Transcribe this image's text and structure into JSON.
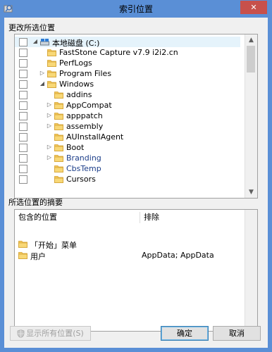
{
  "window": {
    "title": "索引位置",
    "close_glyph": "✕"
  },
  "locations_group": {
    "label": "更改所选位置",
    "items": [
      {
        "label": "本地磁盘 (C:)",
        "level": 0,
        "expanded": true,
        "icon": "drive-icon",
        "selected": true
      },
      {
        "label": "FastStone Capture v7.9 i2i2.cn",
        "level": 1,
        "icon": "folder-icon"
      },
      {
        "label": "PerfLogs",
        "level": 1,
        "icon": "folder-icon"
      },
      {
        "label": "Program Files",
        "level": 1,
        "collapsed": true,
        "icon": "folder-icon"
      },
      {
        "label": "Windows",
        "level": 1,
        "expanded": true,
        "icon": "folder-icon"
      },
      {
        "label": "addins",
        "level": 2,
        "icon": "folder-icon"
      },
      {
        "label": "AppCompat",
        "level": 2,
        "collapsed": true,
        "icon": "folder-icon"
      },
      {
        "label": "apppatch",
        "level": 2,
        "collapsed": true,
        "icon": "folder-icon"
      },
      {
        "label": "assembly",
        "level": 2,
        "collapsed": true,
        "icon": "folder-icon"
      },
      {
        "label": "AUInstallAgent",
        "level": 2,
        "icon": "folder-icon"
      },
      {
        "label": "Boot",
        "level": 2,
        "collapsed": true,
        "icon": "folder-icon"
      },
      {
        "label": "Branding",
        "level": 2,
        "collapsed": true,
        "icon": "folder-icon",
        "blue": true
      },
      {
        "label": "CbsTemp",
        "level": 2,
        "icon": "folder-icon",
        "blue": true
      },
      {
        "label": "Cursors",
        "level": 2,
        "icon": "folder-icon"
      }
    ]
  },
  "summary_group": {
    "label": "所选位置的摘要",
    "col_included": "包含的位置",
    "col_excluded": "排除",
    "rows": [
      {
        "location": "「开始」菜单",
        "excluded": ""
      },
      {
        "location": "用户",
        "excluded": "AppData; AppData"
      }
    ]
  },
  "buttons": {
    "show_all": "显示所有位置(S)",
    "ok": "确定",
    "cancel": "取消"
  }
}
